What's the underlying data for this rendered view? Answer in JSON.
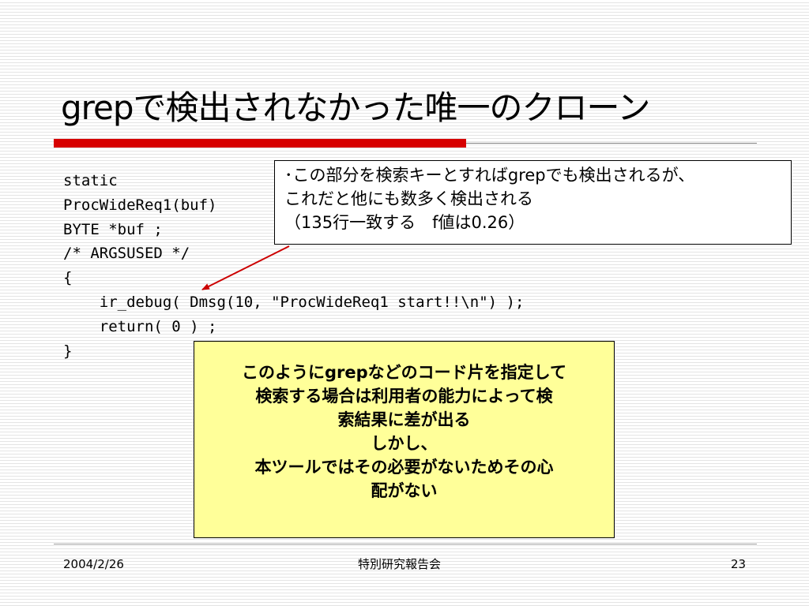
{
  "slide": {
    "title": "grepで検出されなかった唯一のクローン"
  },
  "code": {
    "lines": [
      "static",
      "ProcWideReq1(buf)",
      "BYTE *buf ;",
      "/* ARGSUSED */",
      "{",
      "    ir_debug( Dmsg(10, \"ProcWideReq1 start!!\\n\") );",
      "    return( 0 ) ;",
      "}"
    ]
  },
  "callout": {
    "line1": "･この部分を検索キーとすればgrepでも検出されるが、",
    "line2": "これだと他にも数多く検出される",
    "line3": "（135行一致する　f値は0.26）"
  },
  "note": {
    "line1_prefix": "このように",
    "line1_keyword": "grep",
    "line1_suffix": "などのコード片を指定して",
    "line2": "検索する場合は利用者の能力によって検",
    "line3": "索結果に差が出る",
    "line4": "しかし、",
    "line5": "本ツールではその必要がないためその心",
    "line6": "配がない"
  },
  "footer": {
    "date": "2004/2/26",
    "event": "特別研究報告会",
    "page": "23"
  },
  "colors": {
    "accent_red": "#d70000",
    "note_background": "#ffff99",
    "arrow": "#cc0000"
  }
}
